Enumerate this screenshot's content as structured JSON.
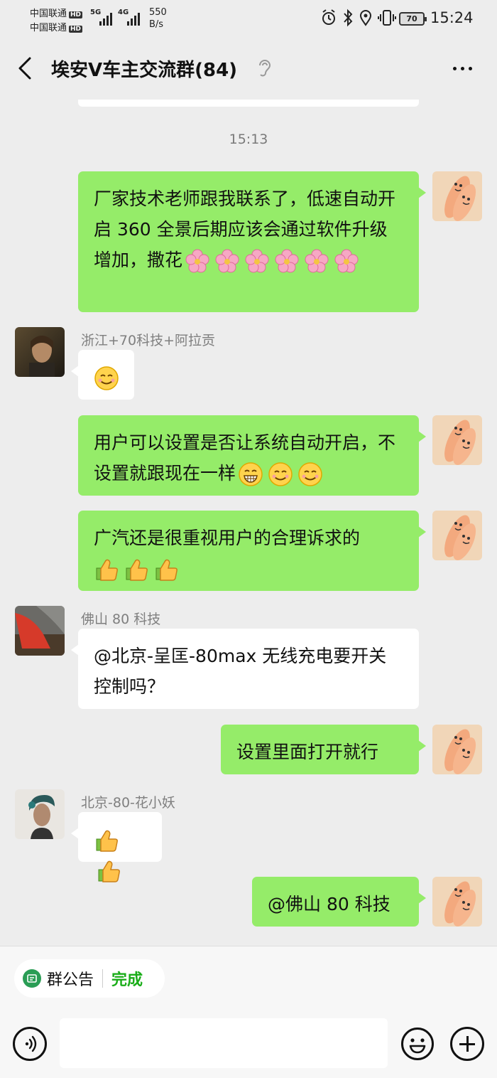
{
  "status_bar": {
    "carrier1": "中国联通",
    "carrier2": "中国联通",
    "hd": "HD",
    "net1": "5G",
    "net2": "4G",
    "speed_value": "550",
    "speed_unit": "B/s",
    "battery": "70",
    "time": "15:24"
  },
  "header": {
    "title": "埃安V车主交流群(84)"
  },
  "chat": {
    "timestamp": "15:13",
    "messages": [
      {
        "sender": "me",
        "text": "厂家技术老师跟我联系了，低速自动开启 360 全景后期应该会通过软件升级增加，撒花",
        "emojis": [
          "cherry-blossom-icon",
          "cherry-blossom-icon",
          "cherry-blossom-icon",
          "cherry-blossom-icon",
          "cherry-blossom-icon",
          "cherry-blossom-icon"
        ]
      },
      {
        "sender": "浙江+70科技+阿拉贡",
        "text": "",
        "emojis": [
          "smiling-face-icon"
        ]
      },
      {
        "sender": "me",
        "text": "用户可以设置是否让系统自动开启，不设置就跟现在一样",
        "emojis": [
          "grinning-face-icon",
          "smiling-face-icon",
          "smiling-face-icon"
        ]
      },
      {
        "sender": "me",
        "text": "广汽还是很重视用户的合理诉求的",
        "emojis": [
          "thumbs-up-icon",
          "thumbs-up-icon",
          "thumbs-up-icon"
        ]
      },
      {
        "sender": "佛山 80 科技",
        "text": "@北京-呈匡-80max  无线充电要开关控制吗？",
        "emojis": []
      },
      {
        "sender": "me",
        "text": "设置里面打开就行",
        "emojis": []
      },
      {
        "sender": "北京-80-花小妖",
        "text": "",
        "emojis": [
          "thumbs-up-icon",
          "thumbs-up-icon"
        ]
      },
      {
        "sender": "me",
        "text": "@佛山 80 科技",
        "emojis": []
      }
    ]
  },
  "bottom": {
    "notice_label": "群公告",
    "notice_done": "完成"
  },
  "colors": {
    "my_bubble": "#95ec69",
    "their_bubble": "#ffffff",
    "background": "#ededed",
    "done_green": "#1aad19"
  }
}
